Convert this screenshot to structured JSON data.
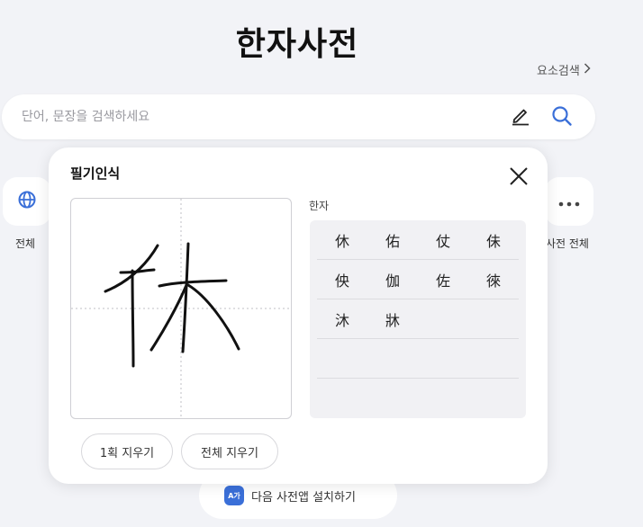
{
  "app": {
    "title": "한자사전",
    "element_search": "요소검색"
  },
  "search": {
    "placeholder": "단어, 문장을 검색하세요"
  },
  "categories": {
    "all_label": "전체",
    "dict_all_label": "사전 전체"
  },
  "install": {
    "badge": "A가",
    "label": "다음 사전앱 설치하기"
  },
  "handwriting": {
    "title": "필기인식",
    "results_label": "한자",
    "rows": [
      [
        "休",
        "佑",
        "仗",
        "佅"
      ],
      [
        "佒",
        "伽",
        "佐",
        "徠"
      ],
      [
        "沐",
        "牀"
      ],
      [],
      []
    ],
    "erase_stroke": "1획 지우기",
    "erase_all": "전체 지우기"
  },
  "colors": {
    "accent": "#3a6fd8",
    "panel_bg": "#ffffff",
    "page_bg": "#f2f3f7"
  }
}
